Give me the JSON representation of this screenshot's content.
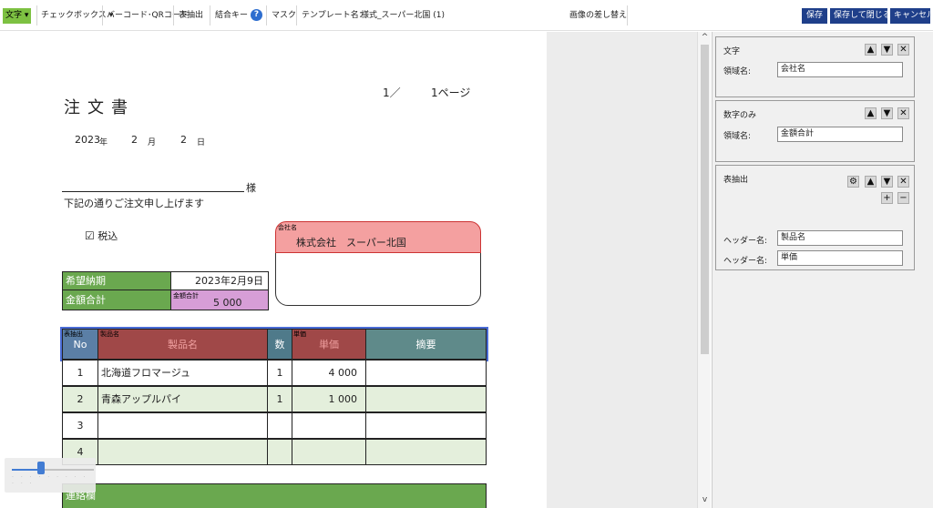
{
  "toolbar": {
    "moji": "文字 ▾",
    "checkbox": "チェックボックス ▾",
    "barcode": "バーコード･QRコード",
    "table_extract": "表抽出",
    "join_key": "結合キー",
    "help": "?",
    "mask": "マスク",
    "template_label": "テンプレート名：",
    "template_name": "様式_スーパー北国 (1)",
    "replace_image": "画像の差し替え",
    "save": "保存",
    "save_close": "保存して閉じる",
    "cancel": "キャンセル"
  },
  "document": {
    "page_current": "1／",
    "page_total": "1ページ",
    "title": "注文書",
    "date_year": "2023",
    "date_year_unit": "年",
    "date_month": "2",
    "date_month_unit": "月",
    "date_day": "2",
    "date_day_unit": "日",
    "sama": "様",
    "note": "下記の通りご注文申し上げます",
    "tax_check": "☑",
    "tax_label": "税込",
    "delivery_label": "希望納期",
    "delivery_value": "2023年2月9日",
    "total_label": "金額合計",
    "total_field_label": "金額合計",
    "total_value": "5 000",
    "company_field_label": "会社名",
    "company_value": "株式会社　スーパー北国",
    "table_field_label": "表抽出",
    "product_field_label": "製品名",
    "price_field_label": "単価",
    "headers": [
      "No",
      "製品名",
      "数",
      "単価",
      "摘要"
    ],
    "rows": [
      {
        "no": "1",
        "name": "北海道フロマージュ",
        "qty": "1",
        "price": "4 000",
        "note": ""
      },
      {
        "no": "2",
        "name": "青森アップルパイ",
        "qty": "1",
        "price": "1 000",
        "note": ""
      },
      {
        "no": "3",
        "name": "",
        "qty": "",
        "price": "",
        "note": ""
      },
      {
        "no": "4",
        "name": "",
        "qty": "",
        "price": "",
        "note": ""
      }
    ],
    "contact_label": "連絡欄"
  },
  "panel": {
    "cards": [
      {
        "title": "文字",
        "field_label": "領域名:",
        "field_value": "会社名"
      },
      {
        "title": "数字のみ",
        "field_label": "領域名:",
        "field_value": "金額合計"
      },
      {
        "title": "表抽出",
        "header1_label": "ヘッダー名:",
        "header1_value": "製品名",
        "header2_label": "ヘッダー名:",
        "header2_value": "単価"
      }
    ]
  },
  "zoom": {
    "level": 0.35
  },
  "colors": {
    "accent": "#7dc142",
    "button": "#1f3f8a",
    "header_green": "#6aa84f",
    "field_pink": "#f4a0a0",
    "field_magenta": "#d79ed7"
  }
}
